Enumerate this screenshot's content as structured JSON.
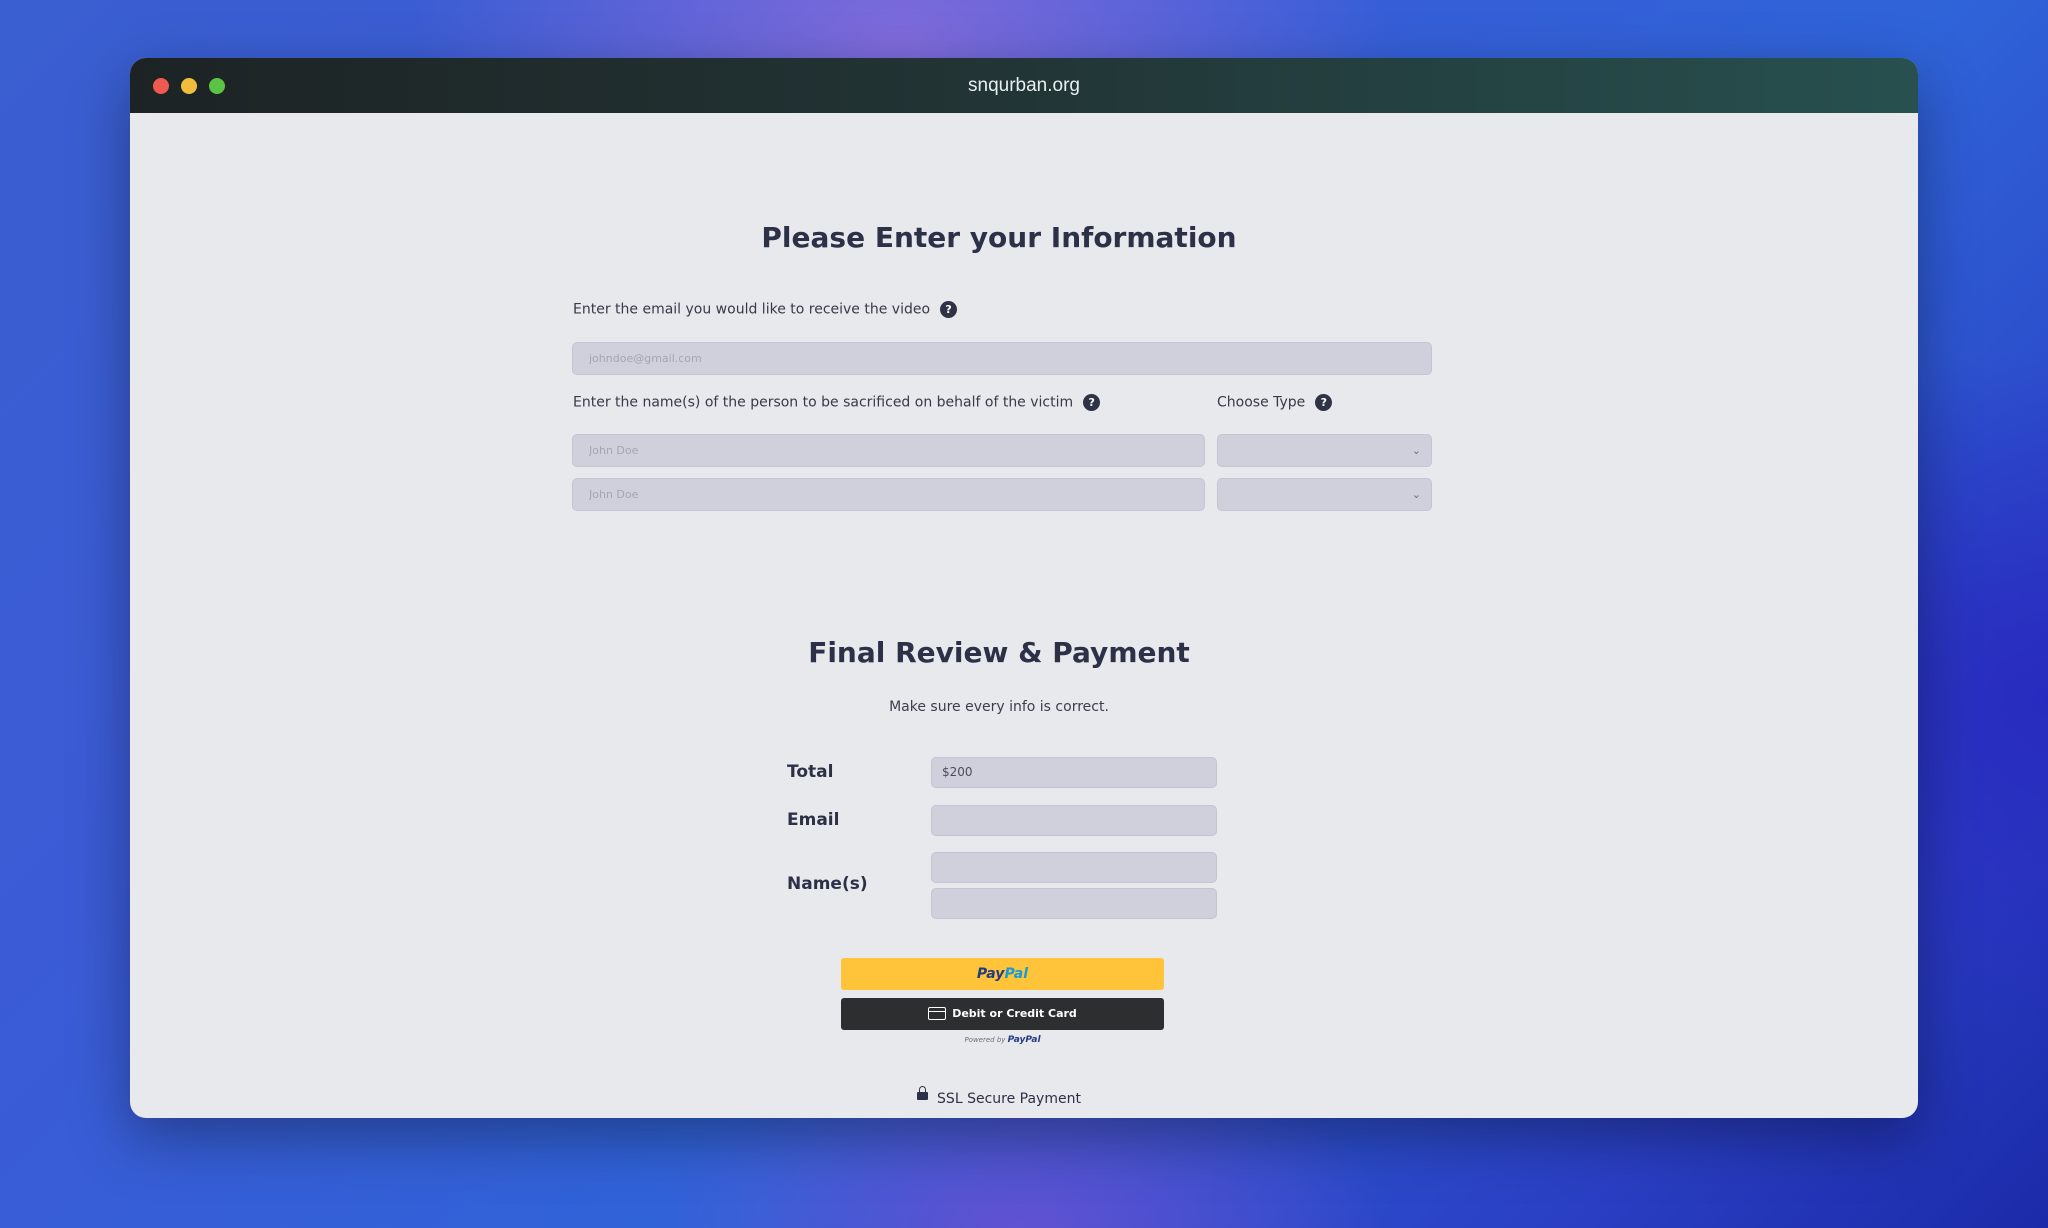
{
  "window": {
    "title": "snqurban.org"
  },
  "info_section": {
    "heading": "Please Enter your Information",
    "email_label": "Enter the email you would like to receive the video",
    "email_placeholder": "johndoe@gmail.com",
    "names_label": "Enter the name(s) of the person to be sacrificed on behalf of the victim",
    "type_label": "Choose Type",
    "help_glyph": "?",
    "name_rows": [
      {
        "name_placeholder": "John Doe",
        "type_value": ""
      },
      {
        "name_placeholder": "John Doe",
        "type_value": ""
      }
    ],
    "chevron_glyph": "⌄"
  },
  "payment_section": {
    "heading": "Final Review & Payment",
    "subtext": "Make sure every info is correct.",
    "total_label": "Total",
    "total_value": "$200",
    "email_label": "Email",
    "email_value": "",
    "names_label": "Name(s)",
    "name_values": [
      "",
      ""
    ],
    "paypal_button": {
      "pay": "Pay",
      "pal": "Pal"
    },
    "card_button_label": "Debit or Credit Card",
    "powered_by_prefix": "Powered by",
    "powered_by_brand": "PayPal",
    "ssl_label": "SSL Secure Payment"
  },
  "colors": {
    "paypal_yellow": "#ffc439",
    "card_button": "#2c2e2f",
    "input_bg": "#cfd0dc",
    "heading": "#2c3147"
  },
  "icons": [
    "help-icon",
    "chevron-down-icon",
    "credit-card-icon",
    "lock-icon"
  ]
}
